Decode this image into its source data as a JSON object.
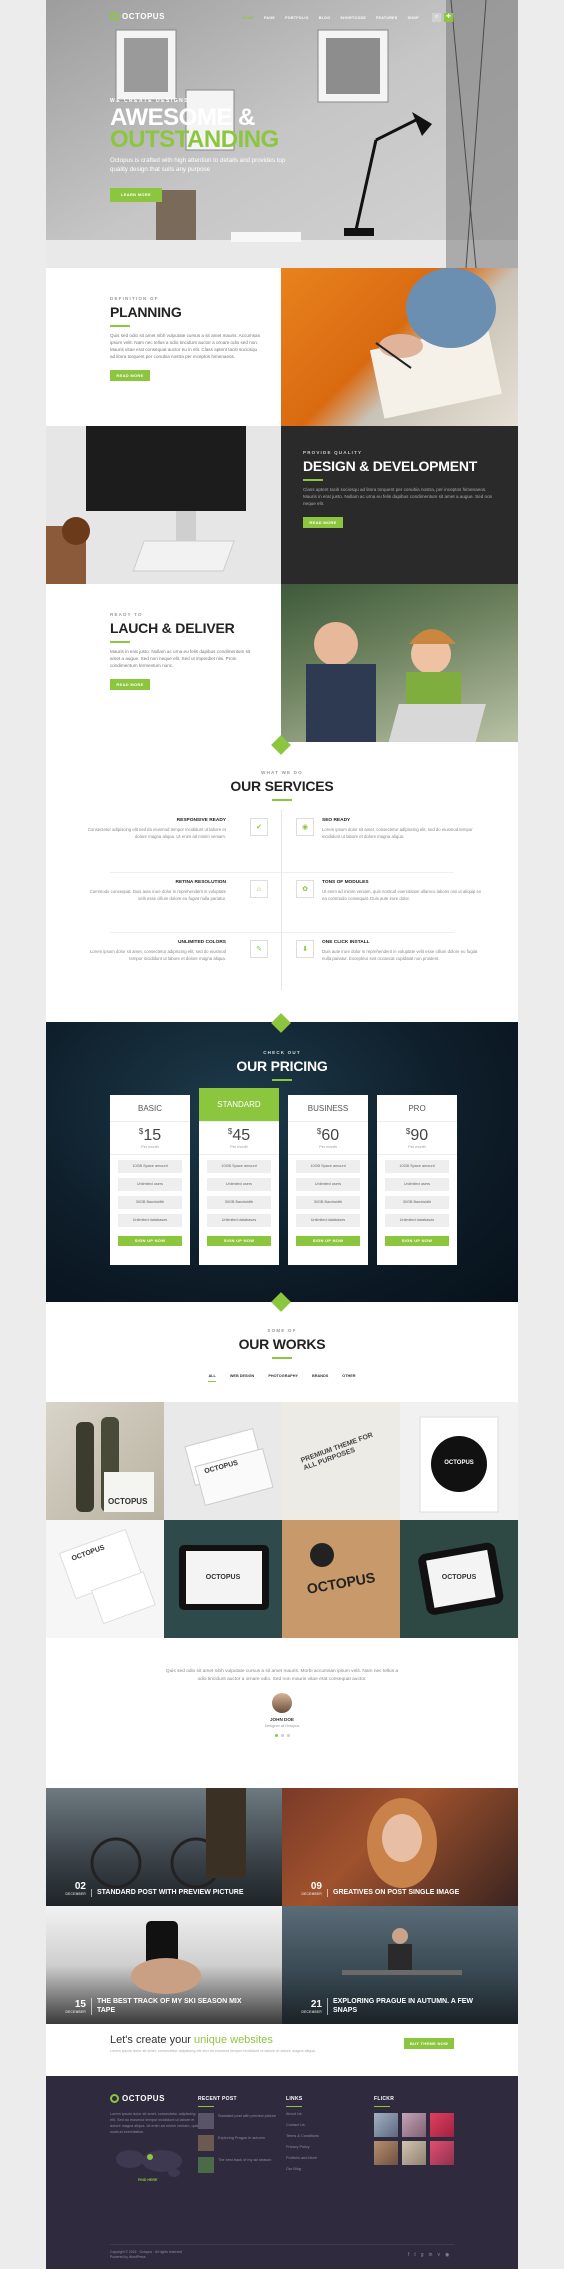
{
  "nav": {
    "brand": "OCTOPUS",
    "items": [
      "HOME",
      "PAGE",
      "PORTFOLIO",
      "BLOG",
      "SHORTCODE",
      "FEATURES",
      "SHOP"
    ],
    "active_index": 0
  },
  "hero": {
    "kicker": "WE CREATE DESIGNS",
    "title_line1": "AWESOME &",
    "title_line2": "OUTSTANDING",
    "text": "Octopus is crafted with high attention to details and provides top quality design that suits any purpose",
    "button": "LEARN MORE"
  },
  "planning": {
    "kicker": "DEFINITION OF",
    "title": "PLANNING",
    "text": "Quis sed odio sit amet nibh vulputate cursus a sit amet mauris. Accumsan ipsum velit. Nam nec tellus a odio tincidunt auctor a ornare odio sed non. Mauris vitae erat consequat auctor eu in elit. Class aptent taciti sociosqu ad litora torquent per conubia nostra per inceptos himenaeos.",
    "button": "READ MORE"
  },
  "design": {
    "kicker": "PROVIDE QUALITY",
    "title": "DESIGN & DEVELOPMENT",
    "text": "Class aptent taciti sociosqu ad litora torquent per conubia nostra, per inceptos himenaeos. Mauris in erat justo. Nullam ac urna eu felis dapibus condimentum sit amet a augue. Sed non neque elit.",
    "button": "READ MORE"
  },
  "launch": {
    "kicker": "READY TO",
    "title": "LAUCH & DELIVER",
    "text": "Mauris in erat justo. Nullam ac urna eu felis dapibus condimentum sit amet a augue. Sed non neque elit. Sed ut imperdiet nisi. Proin condimentum fermentum nunc.",
    "button": "READ MORE"
  },
  "services": {
    "kicker": "WHAT WE DO",
    "title": "OUR SERVICES",
    "items": [
      {
        "title": "RESPONSIVE READY",
        "text": "Consectetur adipiscing elit sed do eiusmod tempor incididunt ut labore et dolore magna aliqua. Ut enim ad minim veniam.",
        "icon": "check-icon",
        "glyph": "✔"
      },
      {
        "title": "SEO READY",
        "text": "Lorem ipsum dolor sit amet, consectetur adipiscing elit, sed do eiusmod tempor incididunt ut labore et dolore magna aliqua.",
        "icon": "target-icon",
        "glyph": "◉"
      },
      {
        "title": "RETINA RESOLUTION",
        "text": "Commodo consequat. Duis aute irure dolor in reprehenderit in voluptate velit esse cillum dolore eu fugiat nulla pariatur.",
        "icon": "home-icon",
        "glyph": "⌂"
      },
      {
        "title": "TONS OF MODULES",
        "text": "Ut enim ad minim veniam, quis nostrud exercitation ullamco laboris nisi ut aliquip ex ea commodo consequat. Duis aute irure dolor.",
        "icon": "gear-icon",
        "glyph": "✿"
      },
      {
        "title": "UNLIMITED COLORS",
        "text": "Lorem ipsum dolor sit amet, consectetur adipiscing elit, sed do eiusmod tempor incididunt ut labore et dolore magna aliqua.",
        "icon": "brush-icon",
        "glyph": "✎"
      },
      {
        "title": "ONE CLICK INSTALL",
        "text": "Duis aute irure dolor in reprehenderit in voluptate velit esse cillum dolore eu fugiat nulla pariatur. Excepteur sint occaecat cupidatat non proident.",
        "icon": "download-icon",
        "glyph": "⬇"
      }
    ]
  },
  "pricing": {
    "kicker": "CHECK OUT",
    "title": "OUR PRICING",
    "plans": [
      {
        "name": "BASIC",
        "price": "15",
        "currency": "$",
        "period": "Per month",
        "features": [
          "10GB Space amount",
          "Unlimited users",
          "30GB Bandwidth",
          "Unlimited databases"
        ],
        "button": "SIGN UP NOW",
        "featured": false
      },
      {
        "name": "STANDARD",
        "price": "45",
        "currency": "$",
        "period": "Per month",
        "features": [
          "10GB Space amount",
          "Unlimited users",
          "30GB Bandwidth",
          "Unlimited databases"
        ],
        "button": "SIGN UP NOW",
        "featured": true
      },
      {
        "name": "BUSINESS",
        "price": "60",
        "currency": "$",
        "period": "Per month",
        "features": [
          "10GB Space amount",
          "Unlimited users",
          "30GB Bandwidth",
          "Unlimited databases"
        ],
        "button": "SIGN UP NOW",
        "featured": false
      },
      {
        "name": "PRO",
        "price": "90",
        "currency": "$",
        "period": "Per month",
        "features": [
          "10GB Space amount",
          "Unlimited users",
          "30GB Bandwidth",
          "Unlimited databases"
        ],
        "button": "SIGN UP NOW",
        "featured": false
      }
    ]
  },
  "works": {
    "kicker": "SOME OF",
    "title": "OUR WORKS",
    "filters": [
      "ALL",
      "WEB DESIGN",
      "PHOTOGRAPHY",
      "BRANDS",
      "OTHER"
    ],
    "active_filter": 0,
    "tile_labels": [
      "OCTOPUS",
      "OCTOPUS",
      "PREMIUM THEME FOR ALL PURPOSES",
      "OCTOPUS",
      "OCTOPUS",
      "OCTOPUS",
      "OCTOPUS",
      "OCTOPUS"
    ]
  },
  "testimonial": {
    "quote": "Quis sed odio sit amet nibh vulputate cursus a sit amet mauris. Morbi accumsan ipsum velit. Nam nec tellus a odio tincidunt auctor a ornare odio. Sed non mauris vitae erat consequat auctor.",
    "name": "JOHN DOE",
    "role": "Designer at Octopus"
  },
  "blog": {
    "posts": [
      {
        "day": "02",
        "month": "DECEMBER",
        "title": "STANDARD POST WITH PREVIEW PICTURE"
      },
      {
        "day": "09",
        "month": "DECEMBER",
        "title": "GREATIVES ON POST SINGLE IMAGE"
      },
      {
        "day": "15",
        "month": "DECEMBER",
        "title": "THE BEST TRACK OF MY SKI SEASON MIX TAPE"
      },
      {
        "day": "21",
        "month": "DECEMBER",
        "title": "EXPLORING PRAGUE IN AUTUMN. A FEW SNAPS"
      }
    ]
  },
  "cta": {
    "text_start": "Let's create your ",
    "text_highlight": "unique websites",
    "subtext": "Lorem ipsum dolor sit amet, consectetur adipiscing elit sed do eiusmod tempor incididunt ut labore et dolore magna aliqua.",
    "button": "BUY THEME NOW"
  },
  "footer": {
    "brand": "OCTOPUS",
    "about": "Lorem ipsum dolor sit amet, consectetur adipiscing elit. Sed do eiusmod tempor incididunt ut labore et dolore magna aliqua. Ut enim ad minim veniam, quis nostrud exercitation.",
    "map_label": "FIND HERE",
    "recent_title": "RECENT POST",
    "recent_posts": [
      "Standard post with preview picture",
      "Exploring Prague in autumn",
      "The best track of my ski season"
    ],
    "links_title": "LINKS",
    "links": [
      "About Us",
      "Contact Us",
      "Terms & Conditions",
      "Privacy Policy",
      "Portfolio and More",
      "Our Blog"
    ],
    "flickr_title": "FLICKR",
    "copyright": "Copyright © 2015 · Octopus · All rights reserved",
    "credit": "Powered by WordPress",
    "social": [
      "facebook-icon",
      "twitter-icon",
      "google-plus-icon",
      "linkedin-icon",
      "vimeo-icon",
      "rss-icon"
    ]
  },
  "colors": {
    "accent": "#8cc63f",
    "dark": "#2a2a2a",
    "footer": "#2f2a3d"
  }
}
